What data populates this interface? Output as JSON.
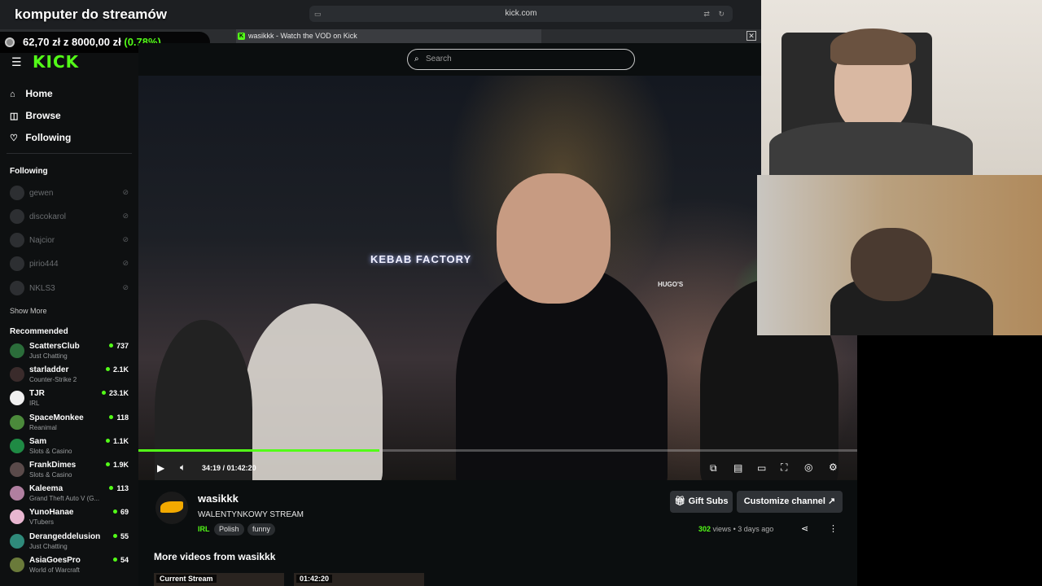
{
  "overlay": {
    "title": "komputer do streamów",
    "goal_amount": "62,70 zł",
    "goal_of": "z",
    "goal_target": "8000,00 zł",
    "goal_percent": "(0.78%)"
  },
  "browser": {
    "url": "kick.com",
    "tab_title": "wasikkk - Watch the VOD on Kick"
  },
  "sidebar": {
    "logo": "KICK",
    "nav": [
      {
        "label": "Home",
        "icon": "home-icon"
      },
      {
        "label": "Browse",
        "icon": "compass-icon"
      },
      {
        "label": "Following",
        "icon": "heart-icon"
      }
    ],
    "following_heading": "Following",
    "following": [
      "gewen",
      "discokarol",
      "Najcior",
      "pirio444",
      "NKLS3"
    ],
    "show_more": "Show More",
    "recommended_heading": "Recommended",
    "recommended": [
      {
        "name": "ScattersClub",
        "category": "Just Chatting",
        "viewers": "737",
        "color": "#2b6d3a"
      },
      {
        "name": "starladder",
        "category": "Counter-Strike 2",
        "viewers": "2.1K",
        "color": "#3a2b2b"
      },
      {
        "name": "TJR",
        "category": "IRL",
        "viewers": "23.1K",
        "color": "#f0f0f0"
      },
      {
        "name": "SpaceMonkee",
        "category": "Reanimal",
        "viewers": "118",
        "color": "#4b8a3b"
      },
      {
        "name": "Sam",
        "category": "Slots & Casino",
        "viewers": "1.1K",
        "color": "#1f8a44"
      },
      {
        "name": "FrankDimes",
        "category": "Slots & Casino",
        "viewers": "1.9K",
        "color": "#5a4a4a"
      },
      {
        "name": "Kaleema",
        "category": "Grand Theft Auto V (G...",
        "viewers": "113",
        "color": "#b07fa0"
      },
      {
        "name": "YunoHanae",
        "category": "VTubers",
        "viewers": "69",
        "color": "#e8b6d0"
      },
      {
        "name": "Derangeddelusion",
        "category": "Just Chatting",
        "viewers": "55",
        "color": "#2f8a7a"
      },
      {
        "name": "AsiaGoesPro",
        "category": "World of Warcraft",
        "viewers": "54",
        "color": "#6a7a3a"
      }
    ]
  },
  "search": {
    "placeholder": "Search"
  },
  "player": {
    "current_time": "34:19",
    "separator": "/",
    "duration": "01:42:20",
    "progress": 0.335,
    "sign_text": "KEBAB FACTORY",
    "sign_text2": "HUGO'S"
  },
  "channel": {
    "name": "wasikkk",
    "stream_title": "WALENTYNKOWY STREAM",
    "category": "IRL",
    "tags": [
      "Polish",
      "funny"
    ],
    "gift_button": "Gift Subs",
    "customize_button": "Customize channel",
    "views_count": "302",
    "views_label": "views",
    "age": "3 days ago"
  },
  "more_videos": {
    "heading": "More videos from wasikkk",
    "thumbs": [
      "Current Stream",
      "01:42:20"
    ]
  },
  "colors": {
    "accent": "#53fc18",
    "background": "#0b0e0f"
  }
}
